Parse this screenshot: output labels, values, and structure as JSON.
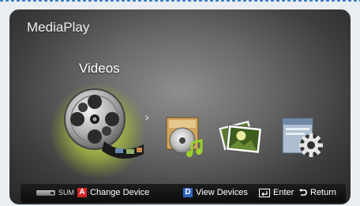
{
  "app": {
    "title": "MediaPlay"
  },
  "menu": {
    "selected_label": "Videos",
    "items": [
      {
        "name": "Videos",
        "icon": "film-reel-icon"
      },
      {
        "name": "Music",
        "icon": "music-disc-icon"
      },
      {
        "name": "Photos",
        "icon": "photos-icon"
      },
      {
        "name": "Setup",
        "icon": "settings-gear-icon"
      }
    ]
  },
  "bottom_bar": {
    "sum": "SUM",
    "change_device_key": "A",
    "change_device": "Change Device",
    "view_devices_key": "D",
    "view_devices": "View Devices",
    "enter": "Enter",
    "return": "Return"
  },
  "colors": {
    "key_a": "#d3262a",
    "key_d": "#2f63c0",
    "selection_glow": "#c5d84e"
  }
}
